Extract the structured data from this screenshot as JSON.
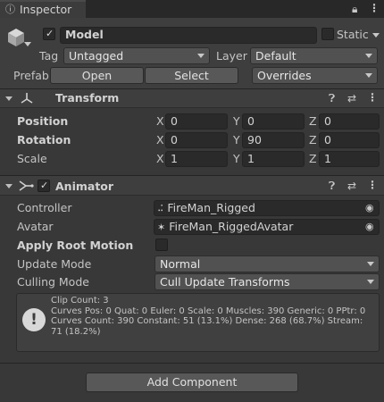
{
  "tab": {
    "title": "Inspector"
  },
  "object": {
    "name": "Model",
    "static_label": "Static",
    "tag_label": "Tag",
    "tag_value": "Untagged",
    "layer_label": "Layer",
    "layer_value": "Default",
    "prefab_label": "Prefab",
    "open_label": "Open",
    "select_label": "Select",
    "overrides_label": "Overrides"
  },
  "transform": {
    "title": "Transform",
    "position_label": "Position",
    "rotation_label": "Rotation",
    "scale_label": "Scale",
    "axis_x": "X",
    "axis_y": "Y",
    "axis_z": "Z",
    "position": {
      "x": "0",
      "y": "0",
      "z": "0"
    },
    "rotation": {
      "x": "0",
      "y": "90",
      "z": "0"
    },
    "scale": {
      "x": "1",
      "y": "1",
      "z": "1"
    }
  },
  "animator": {
    "title": "Animator",
    "controller_label": "Controller",
    "controller_value": "FireMan_Rigged",
    "avatar_label": "Avatar",
    "avatar_value": "FireMan_RiggedAvatar",
    "apply_root_motion_label": "Apply Root Motion",
    "update_mode_label": "Update Mode",
    "update_mode_value": "Normal",
    "culling_mode_label": "Culling Mode",
    "culling_mode_value": "Cull Update Transforms",
    "info_line1": "Clip Count: 3",
    "info_line2": "Curves Pos: 0 Quat: 0 Euler: 0 Scale: 0 Muscles: 390 Generic: 0 PPtr: 0",
    "info_line3": "Curves Count: 390 Constant: 51 (13.1%) Dense: 268 (68.7%) Stream:",
    "info_line4": "71 (18.2%)"
  },
  "footer": {
    "add_component_label": "Add Component"
  },
  "colors": {
    "panel": "#383838",
    "header": "#3e3e3e",
    "field": "#2a2a2a",
    "button": "#585858"
  }
}
